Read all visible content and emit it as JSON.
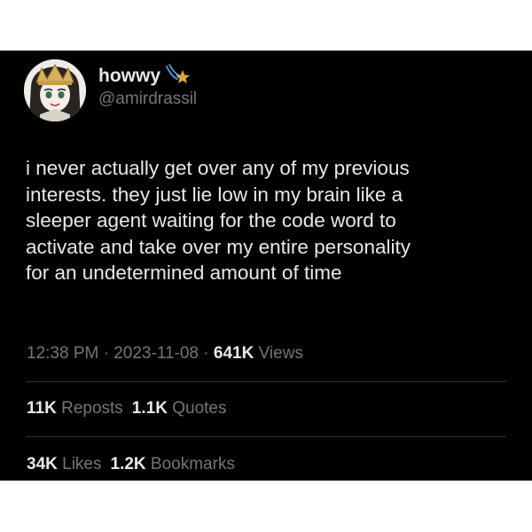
{
  "user": {
    "display_name": "howwy",
    "handle": "@amirdrassil",
    "avatar_icon": "anime-character-avatar",
    "badge_icon": "shooting-star-icon"
  },
  "tweet": {
    "lines": [
      "i never actually get over any of my previous",
      "interests. they just lie low in my brain like a",
      "sleeper agent waiting for the code word to",
      "activate and take over my entire personality",
      "for an undetermined amount of time"
    ]
  },
  "meta": {
    "time": "12:38 PM",
    "separator": "·",
    "date": "2023-11-08",
    "views_count": "641K",
    "views_label": "Views"
  },
  "stats": {
    "reposts_count": "11K",
    "reposts_label": "Reposts",
    "quotes_count": "1.1K",
    "quotes_label": "Quotes",
    "likes_count": "34K",
    "likes_label": "Likes",
    "bookmarks_count": "1.2K",
    "bookmarks_label": "Bookmarks"
  },
  "colors": {
    "background": "#000000",
    "text_primary": "#e7e9ea",
    "text_secondary": "#71767b",
    "divider": "#2f3336",
    "badge_gold": "#d9a93b"
  }
}
